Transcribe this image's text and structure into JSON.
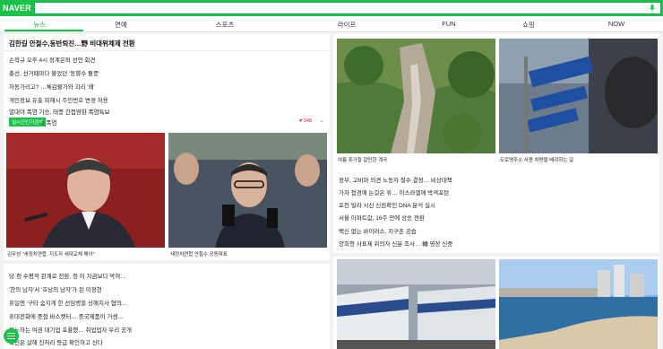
{
  "header": {
    "logo": "NAVER",
    "search_placeholder": ""
  },
  "tabs": [
    {
      "label": "뉴스",
      "active": true
    },
    {
      "label": "연예"
    },
    {
      "label": "스포츠"
    },
    {
      "label": "라이프"
    },
    {
      "label": "FUN"
    },
    {
      "label": "쇼핑"
    },
    {
      "label": "NOW"
    }
  ],
  "left_card": {
    "headline": "김한길 안철수,동반퇴진…野 비대위체제 전환",
    "items": [
      "손학규 오후 4시 정계은퇴 선언 회견",
      "총선, 선거때마다 불었던 '동향수 돌풍'",
      "자동가리고? …체감물가와 괴리 '왜'",
      "개인정보 유출 피해시 주민번호 변경 허용",
      "열대야 폭염 기승, 태풍 간접영향     폭염특보"
    ],
    "badge": "실시간인기검색",
    "badge_text": "1 폭염",
    "likes": "♥ 348",
    "captions": [
      "김무성 \"새정치연합, 지도자 세대교체 해야\"",
      "새정치연합 안철수 공동대표"
    ]
  },
  "left_card2": {
    "items": [
      "당·청 수평적 관계로 전환, 청 이 지금보다 막혀…",
      "'한의 남자'서 '호남의 남자'가 된 이정현",
      "휴일엔 '구타 숨지게 한 선임병들 상해치사 혐의…",
      "휴대전화에 중점 바스켓터… 중국제품이 거센…",
      "분노하는 여권 대기업 포퓰했… 취업업자 우리 공개",
      "국민은 살해 진저리 등급 확인하고 신다"
    ]
  },
  "right_card": {
    "captions": [
      "여름 휴가철 갈만한 계곡",
      "도로명주소 사용 차량을 배려하는 길"
    ],
    "items": [
      "정부, 고비마 의견 노동자 철수 결정… 비상대책",
      "가자 접경에 논길은 휴… 이스라엘에 박격포탄",
      "포천 빌라 시신 신원확인 DNA 분석 실시",
      "서울 아파트값, 16주 만에 상승 전환",
      "백신 없는 바이러스, 지구촌 공습",
      "양희청 사표제 위의자 신분 조사… 轉 영장 신중"
    ]
  },
  "colors": {
    "brand": "#19c24a",
    "background": "#f2f2f2"
  }
}
